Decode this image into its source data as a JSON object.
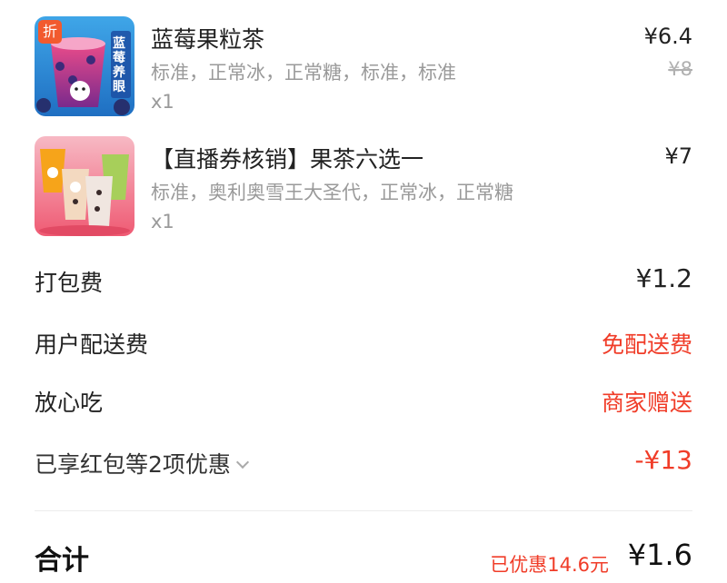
{
  "items": [
    {
      "name": "蓝莓果粒茶",
      "spec": "标准，正常冰，正常糖，标准，标准",
      "qty": "x1",
      "price": "¥6.4",
      "original_price": "¥8",
      "badge": "折",
      "image_caption": "蓝莓养眼",
      "image_icon": "blueberry-tea-image"
    },
    {
      "name": "【直播券核销】果茶六选一",
      "spec": "标准，奥利奥雪王大圣代，正常冰，正常糖",
      "qty": "x1",
      "price": "¥7",
      "image_icon": "fruit-tea-assortment-image"
    }
  ],
  "fees": [
    {
      "label": "打包费",
      "value": "¥1.2",
      "style": "dark"
    },
    {
      "label": "用户配送费",
      "value": "免配送费",
      "style": "red"
    },
    {
      "label": "放心吃",
      "value": "商家赠送",
      "style": "red"
    },
    {
      "label": "已享红包等2项优惠",
      "value": "-¥13",
      "style": "red"
    }
  ],
  "total": {
    "label": "合计",
    "saved": "已优惠14.6元",
    "value": "¥1.6"
  },
  "colors": {
    "accent_red": "#f03c28",
    "text_dark": "#222222",
    "text_grey": "#9a9a9a"
  }
}
